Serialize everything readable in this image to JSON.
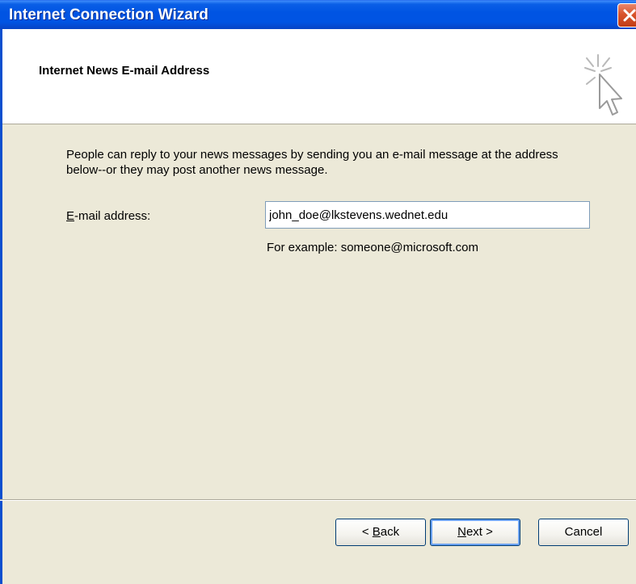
{
  "window": {
    "title": "Internet Connection Wizard"
  },
  "header": {
    "title": "Internet News E-mail Address"
  },
  "body": {
    "intro": "People can reply to your news messages by sending you an e-mail message at the address below--or they may post another news message.",
    "email_label_underlined": "E",
    "email_label_rest": "-mail address:",
    "email_value": "john_doe@lkstevens.wednet.edu",
    "example": "For example: someone@microsoft.com"
  },
  "buttons": {
    "back_prefix": "< ",
    "back_underlined": "B",
    "back_rest": "ack",
    "next_underlined": "N",
    "next_rest": "ext >",
    "cancel": "Cancel"
  },
  "colors": {
    "titlebar": "#0054e3",
    "dialog_bg": "#ece9d8",
    "close_button": "#d8542c"
  },
  "icons": {
    "wizard": "wizard-cursor-icon",
    "close": "close-icon"
  }
}
